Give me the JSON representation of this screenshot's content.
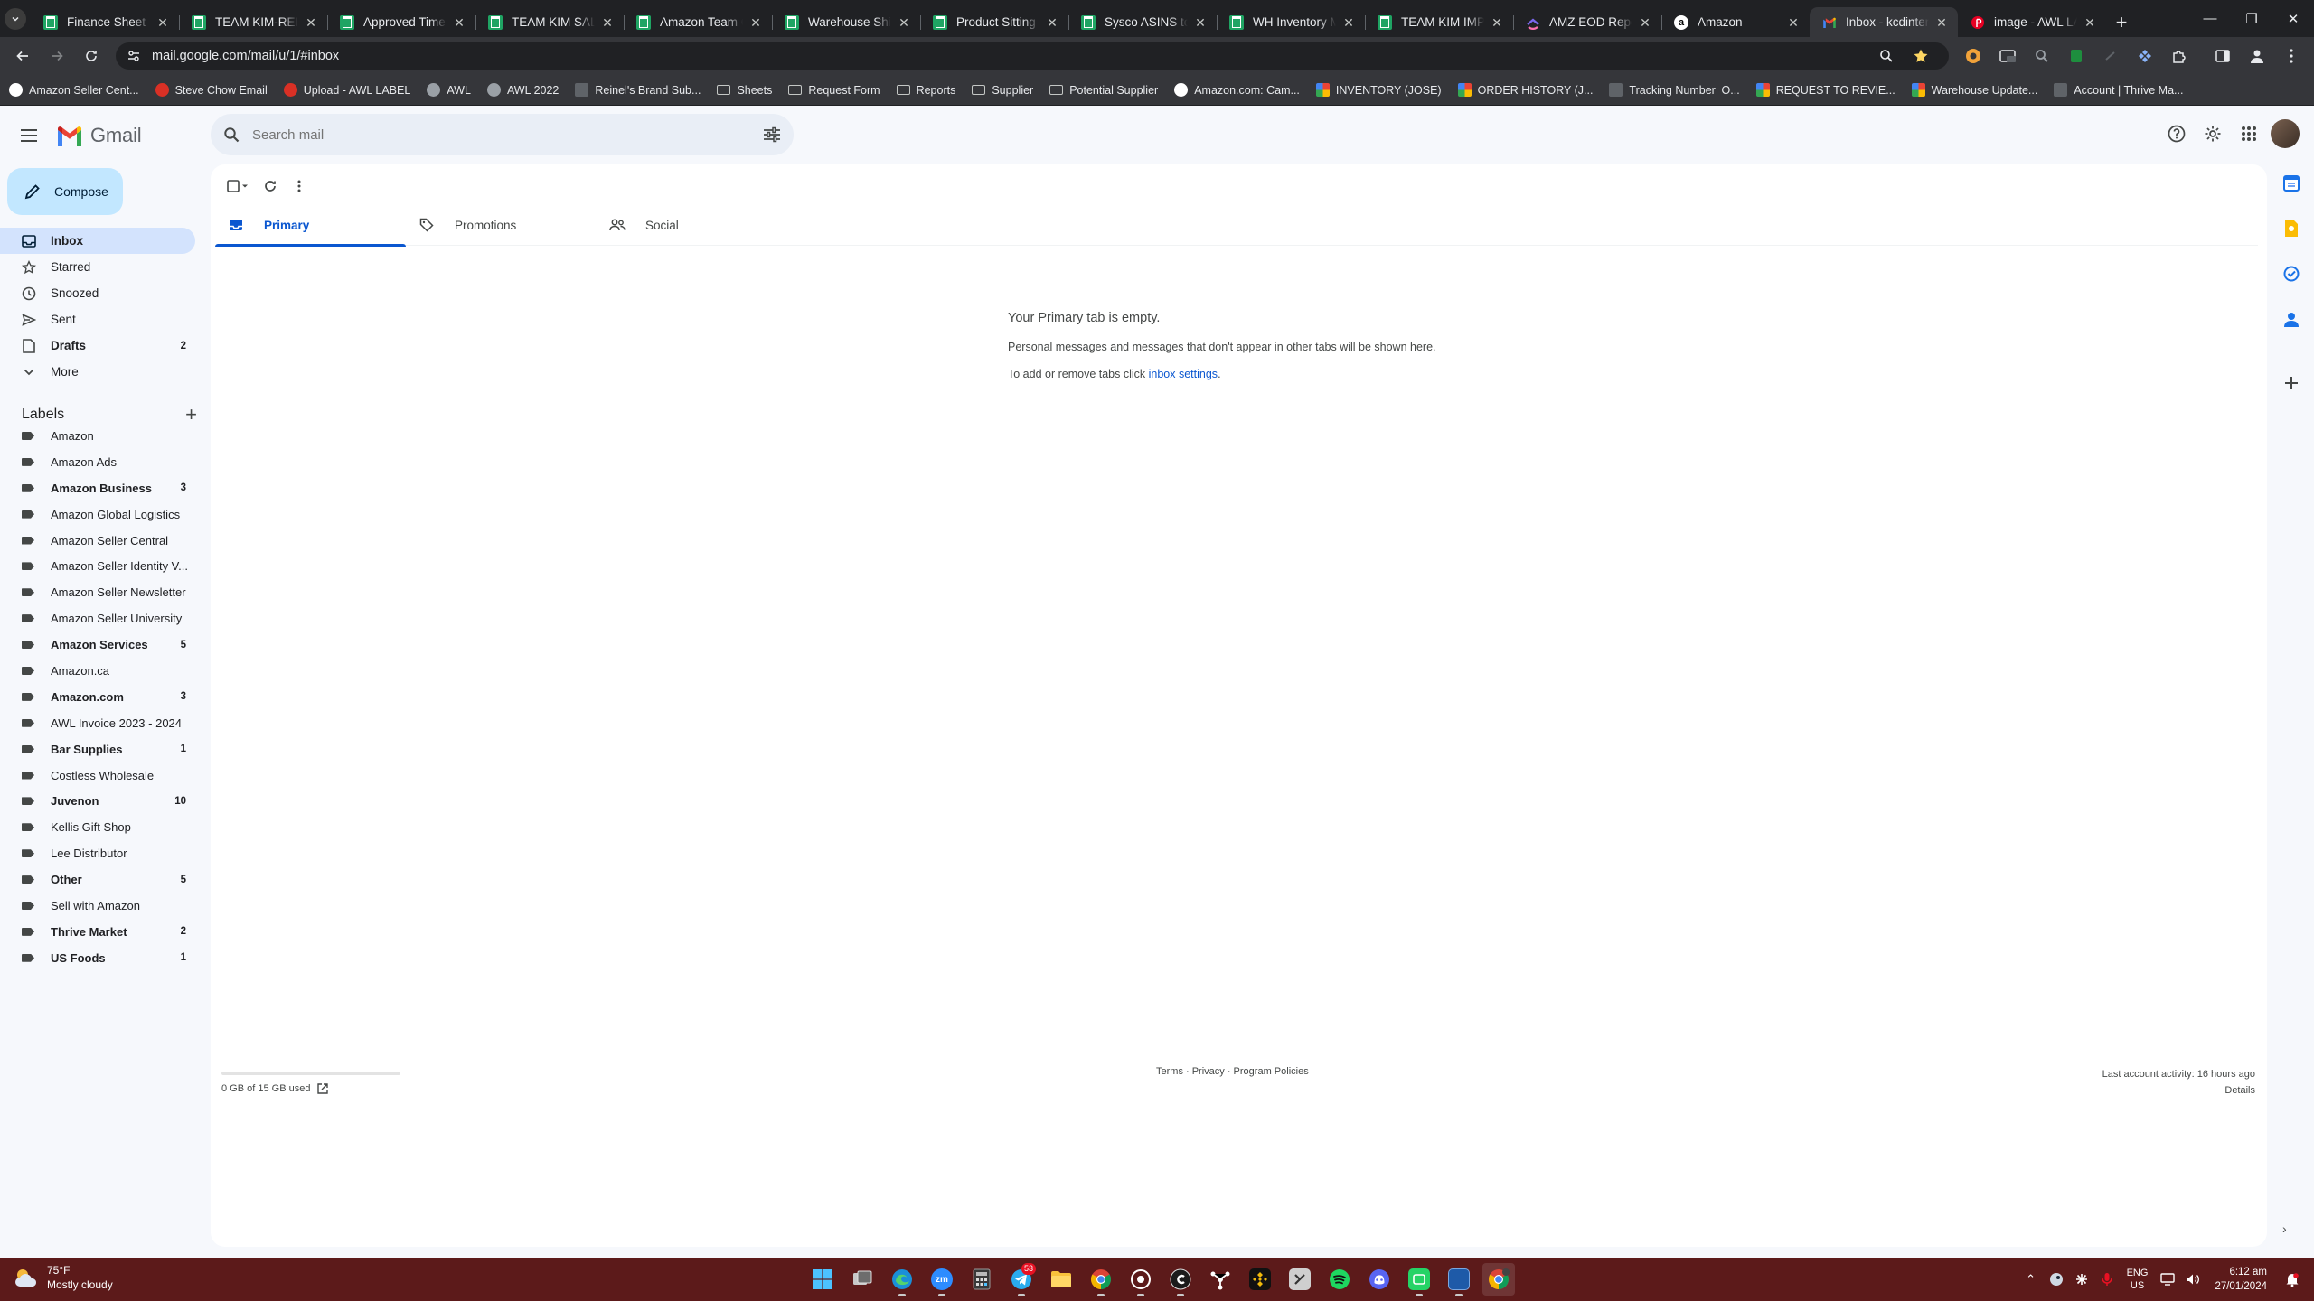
{
  "browser": {
    "tabs": [
      {
        "title": "Finance Sheet - a",
        "icon": "sheets-icon"
      },
      {
        "title": "TEAM KIM-REINE",
        "icon": "sheets-icon"
      },
      {
        "title": "Approved Time S",
        "icon": "sheets-icon"
      },
      {
        "title": "TEAM KIM SALES",
        "icon": "sheets-icon"
      },
      {
        "title": "Amazon Team Or",
        "icon": "sheets-icon"
      },
      {
        "title": "Warehouse Shipp",
        "icon": "sheets-icon"
      },
      {
        "title": "Product Sitting In",
        "icon": "sheets-icon"
      },
      {
        "title": "Sysco ASINS to p",
        "icon": "sheets-icon"
      },
      {
        "title": "WH Inventory Ma",
        "icon": "sheets-icon"
      },
      {
        "title": "TEAM KIM IMPO",
        "icon": "sheets-icon"
      },
      {
        "title": "AMZ EOD Report",
        "icon": "clickup-icon"
      },
      {
        "title": "Amazon",
        "icon": "amazon-icon"
      },
      {
        "title": "Inbox - kcdinterna",
        "icon": "gmail-icon",
        "active": true
      },
      {
        "title": "image - AWL LAB",
        "icon": "pinterest-icon"
      }
    ],
    "url": "mail.google.com/mail/u/1/#inbox",
    "bookmarks": [
      {
        "label": "Amazon Seller Cent...",
        "icon": "amazon-icon"
      },
      {
        "label": "Steve Chow Email",
        "icon": "gmail-icon"
      },
      {
        "label": "Upload - AWL LABEL",
        "icon": "pinterest-icon"
      },
      {
        "label": "AWL",
        "icon": "globe-icon"
      },
      {
        "label": "AWL 2022",
        "icon": "globe-icon"
      },
      {
        "label": "Reinel's Brand Sub...",
        "icon": "page-icon"
      },
      {
        "label": "Sheets",
        "icon": "folder-icon"
      },
      {
        "label": "Request Form",
        "icon": "folder-icon"
      },
      {
        "label": "Reports",
        "icon": "folder-icon"
      },
      {
        "label": "Supplier",
        "icon": "folder-icon"
      },
      {
        "label": "Potential Supplier",
        "icon": "folder-icon"
      },
      {
        "label": "Amazon.com: Cam...",
        "icon": "amazon-icon"
      },
      {
        "label": "INVENTORY (JOSE)",
        "icon": "clickup-icon"
      },
      {
        "label": "ORDER HISTORY (J...",
        "icon": "clickup-icon"
      },
      {
        "label": "Tracking Number| O...",
        "icon": "page-icon"
      },
      {
        "label": "REQUEST TO REVIE...",
        "icon": "clickup-icon"
      },
      {
        "label": "Warehouse Update...",
        "icon": "clickup-icon"
      },
      {
        "label": "Account | Thrive Ma...",
        "icon": "page-icon"
      }
    ]
  },
  "gmail": {
    "logo_text": "Gmail",
    "search_placeholder": "Search mail",
    "compose_label": "Compose",
    "nav": [
      {
        "label": "Inbox",
        "icon": "inbox-icon",
        "count": "",
        "selected": true
      },
      {
        "label": "Starred",
        "icon": "star-icon",
        "count": ""
      },
      {
        "label": "Snoozed",
        "icon": "clock-icon",
        "count": ""
      },
      {
        "label": "Sent",
        "icon": "send-icon",
        "count": ""
      },
      {
        "label": "Drafts",
        "icon": "draft-icon",
        "count": "2",
        "bold": true
      },
      {
        "label": "More",
        "icon": "chevron-down-icon",
        "count": ""
      }
    ],
    "labels_heading": "Labels",
    "labels": [
      {
        "label": "Amazon",
        "count": ""
      },
      {
        "label": "Amazon Ads",
        "count": ""
      },
      {
        "label": "Amazon Business",
        "count": "3",
        "bold": true
      },
      {
        "label": "Amazon Global Logistics",
        "count": ""
      },
      {
        "label": "Amazon Seller Central",
        "count": ""
      },
      {
        "label": "Amazon Seller Identity V...",
        "count": ""
      },
      {
        "label": "Amazon Seller Newsletter",
        "count": ""
      },
      {
        "label": "Amazon Seller University",
        "count": ""
      },
      {
        "label": "Amazon Services",
        "count": "5",
        "bold": true
      },
      {
        "label": "Amazon.ca",
        "count": ""
      },
      {
        "label": "Amazon.com",
        "count": "3",
        "bold": true
      },
      {
        "label": "AWL Invoice 2023 - 2024",
        "count": ""
      },
      {
        "label": "Bar Supplies",
        "count": "1",
        "bold": true
      },
      {
        "label": "Costless Wholesale",
        "count": ""
      },
      {
        "label": "Juvenon",
        "count": "10",
        "bold": true
      },
      {
        "label": "Kellis Gift Shop",
        "count": ""
      },
      {
        "label": "Lee Distributor",
        "count": ""
      },
      {
        "label": "Other",
        "count": "5",
        "bold": true
      },
      {
        "label": "Sell with Amazon",
        "count": ""
      },
      {
        "label": "Thrive Market",
        "count": "2",
        "bold": true
      },
      {
        "label": "US Foods",
        "count": "1",
        "bold": true
      }
    ],
    "tabs": [
      {
        "label": "Primary",
        "icon": "inbox-icon",
        "selected": true
      },
      {
        "label": "Promotions",
        "icon": "tag-icon"
      },
      {
        "label": "Social",
        "icon": "people-icon"
      }
    ],
    "empty": {
      "heading": "Your Primary tab is empty.",
      "line1": "Personal messages and messages that don't appear in other tabs will be shown here.",
      "line2_prefix": "To add or remove tabs click ",
      "line2_link": "inbox settings",
      "line2_suffix": "."
    },
    "footer": {
      "storage_text": "0 GB of 15 GB used",
      "storage_used_fraction": 0,
      "links": "Terms · Privacy · Program Policies",
      "activity": "Last account activity: 16 hours ago",
      "details": "Details"
    }
  },
  "taskbar": {
    "weather_temp": "75°F",
    "weather_desc": "Mostly cloudy",
    "telegram_badge": "53",
    "lang_line1": "ENG",
    "lang_line2": "US",
    "time": "6:12 am",
    "date": "27/01/2024"
  },
  "colors": {
    "accent": "#0b57d0",
    "compose_bg": "#c2e7ff",
    "selected_nav_bg": "#d3e3fd",
    "taskbar_bg": "#5c1a1a"
  }
}
